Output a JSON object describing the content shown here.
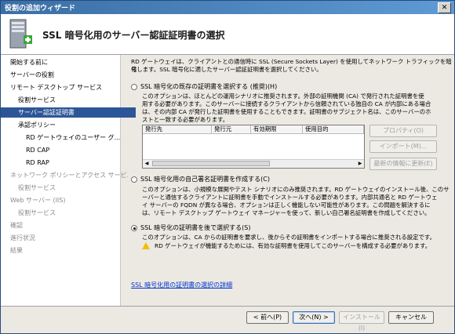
{
  "window": {
    "title": "役割の追加ウィザード",
    "close_glyph": "✕"
  },
  "header": {
    "title": "SSL 暗号化用のサーバー認証証明書の選択"
  },
  "sidebar": {
    "items": [
      {
        "label": "開始する前に",
        "level": 0,
        "state": "normal"
      },
      {
        "label": "サーバーの役割",
        "level": 0,
        "state": "normal"
      },
      {
        "label": "リモート デスクトップ サービス",
        "level": 0,
        "state": "normal"
      },
      {
        "label": "役割サービス",
        "level": 1,
        "state": "normal"
      },
      {
        "label": "サーバー認証証明書",
        "level": 1,
        "state": "selected"
      },
      {
        "label": "承認ポリシー",
        "level": 1,
        "state": "normal"
      },
      {
        "label": "RD ゲートウェイのユーザー グ...",
        "level": 2,
        "state": "normal"
      },
      {
        "label": "RD CAP",
        "level": 2,
        "state": "normal"
      },
      {
        "label": "RD RAP",
        "level": 2,
        "state": "normal"
      },
      {
        "label": "ネットワーク ポリシーとアクセス サービ...",
        "level": 0,
        "state": "dim"
      },
      {
        "label": "役割サービス",
        "level": 1,
        "state": "dim"
      },
      {
        "label": "Web サーバー (IIS)",
        "level": 0,
        "state": "dim"
      },
      {
        "label": "役割サービス",
        "level": 1,
        "state": "dim"
      },
      {
        "label": "確認",
        "level": 0,
        "state": "dim"
      },
      {
        "label": "進行状況",
        "level": 0,
        "state": "dim"
      },
      {
        "label": "結果",
        "level": 0,
        "state": "dim"
      }
    ]
  },
  "intro": {
    "line1": "RD ゲートウェイは、クライアントとの通信時に SSL (Secure Sockets Layer) を使用してネットワーク トラフィックを暗号",
    "line2": "化します。SSL 暗号化に適したサーバー認証証明書を選択してください。"
  },
  "option1": {
    "label": "SSL 暗号化の既存の証明書を選択する (推奨)(H)",
    "selected": false,
    "desc1": "このオプションは、ほとんどの運用シナリオに推奨されます。外部の証明機関 (CA) で発行された証明書を使",
    "desc2": "用する必要があります。このサーバーに接続するクライアントから信頼されている独自の CA が内部にある場合",
    "desc3": "は、その内部 CA が発行した証明書を使用することもできます。証明書のサブジェクト名は、このサーバーのホ",
    "desc4": "ストと一致する必要があります。",
    "columns": [
      "発行先",
      "発行元",
      "有効期限",
      "使用目的"
    ],
    "buttons": {
      "properties": "プロパティ(O)",
      "import": "インポート(M)...",
      "refresh": "最新の情報に更新(E)"
    }
  },
  "option2": {
    "label": "SSL 暗号化用の自己署名証明書を作成する(C)",
    "selected": false,
    "desc1": "このオプションは、小規模な展開やテスト シナリオにのみ推奨されます。RD ゲートウェイのインストール後、このサ",
    "desc2": "ーバーと通信するクライアントに証明書を手動でインストールする必要があります。内部共通名と RD ゲートウェ",
    "desc3": "イ サーバーの FQDN が異なる場合、オプションは正しく機能しない可能性があります。この問題を解決するに",
    "desc4": "は、リモート デスクトップ ゲートウェイ マネージャーを使って、新しい自己署名証明書を作成してください。"
  },
  "option3": {
    "label": "SSL 暗号化の証明書を後で選択する(S)",
    "selected": true,
    "desc1": "このオプションは、CA からの証明書を要求し、後からその証明書をインポートする場合に推奨される設定です。",
    "warning": "RD ゲートウェイが機能するためには、有効な証明書を使用してこのサーバーを構成する必要があります。"
  },
  "help_link": "SSL 暗号化用の証明書の選択の詳細",
  "footer": {
    "back": "< 前へ(P)",
    "next": "次へ(N) >",
    "install": "インストール(I)",
    "cancel": "キャンセル"
  },
  "colors": {
    "selection": "#2c5697",
    "link": "#0033cc",
    "warning": "#f0c000"
  }
}
